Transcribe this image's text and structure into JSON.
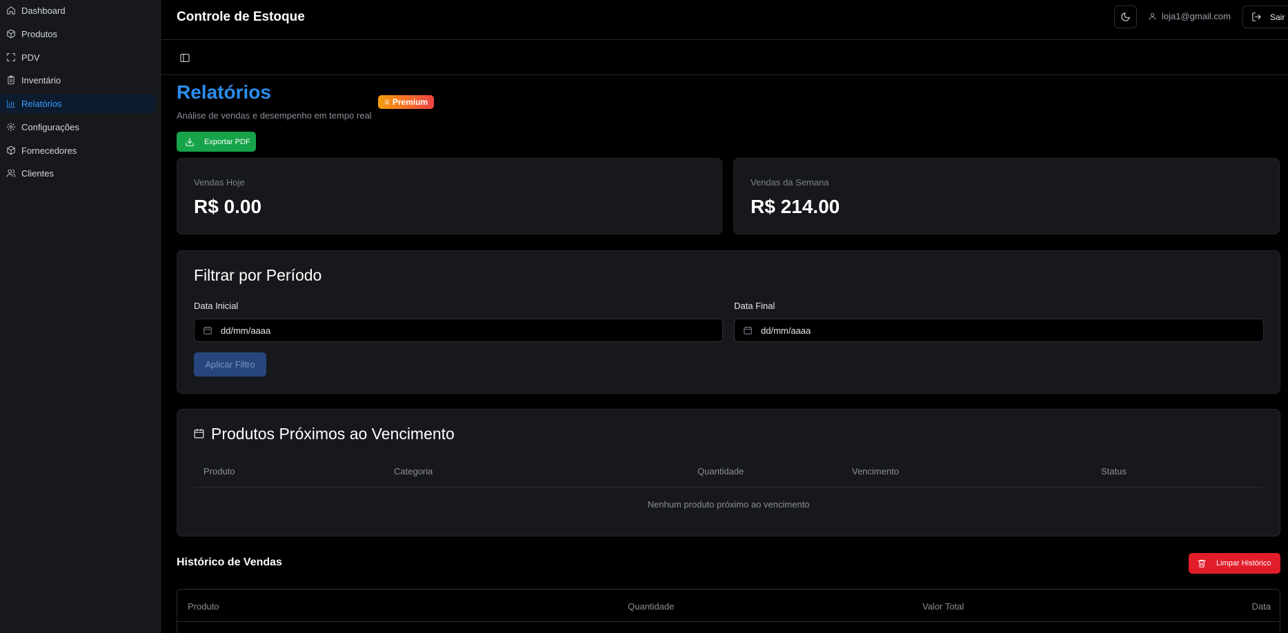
{
  "app": {
    "title": "Controle de Estoque"
  },
  "header": {
    "user_email": "loja1@gmail.com",
    "logout_label": "Sair"
  },
  "sidebar": {
    "items": [
      {
        "label": "Dashboard",
        "icon": "home-icon"
      },
      {
        "label": "Produtos",
        "icon": "package-icon"
      },
      {
        "label": "PDV",
        "icon": "scan-icon"
      },
      {
        "label": "Inventário",
        "icon": "clipboard-icon"
      },
      {
        "label": "Relatórios",
        "icon": "bar-chart-icon",
        "active": true
      },
      {
        "label": "Configurações",
        "icon": "gear-icon"
      },
      {
        "label": "Fornecedores",
        "icon": "package-icon"
      },
      {
        "label": "Clientes",
        "icon": "users-icon"
      }
    ]
  },
  "page": {
    "title": "Relatórios",
    "subtitle": "Análise de vendas e desempenho em tempo real",
    "badge": "Premium",
    "export_label": "Exportar PDF"
  },
  "stats": {
    "today": {
      "label": "Vendas Hoje",
      "value": "R$ 0.00"
    },
    "week": {
      "label": "Vendas da Semana",
      "value": "R$ 214.00"
    }
  },
  "filter": {
    "title": "Filtrar por Período",
    "start_label": "Data Inicial",
    "start_placeholder": "dd/mm/aaaa",
    "end_label": "Data Final",
    "end_placeholder": "dd/mm/aaaa",
    "apply_label": "Aplicar Filtro"
  },
  "expiring": {
    "title": "Produtos Próximos ao Vencimento",
    "columns": [
      "Produto",
      "Categoria",
      "Quantidade",
      "Vencimento",
      "Status"
    ],
    "empty_message": "Nenhum produto próximo ao vencimento"
  },
  "history": {
    "title": "Histórico de Vendas",
    "clear_label": "Limpar Histórico",
    "columns": [
      "Produto",
      "Quantidade",
      "Valor Total",
      "Data"
    ]
  },
  "colors": {
    "accent": "#2b8ef0",
    "success": "#16a34a",
    "danger": "#e11d2a"
  }
}
